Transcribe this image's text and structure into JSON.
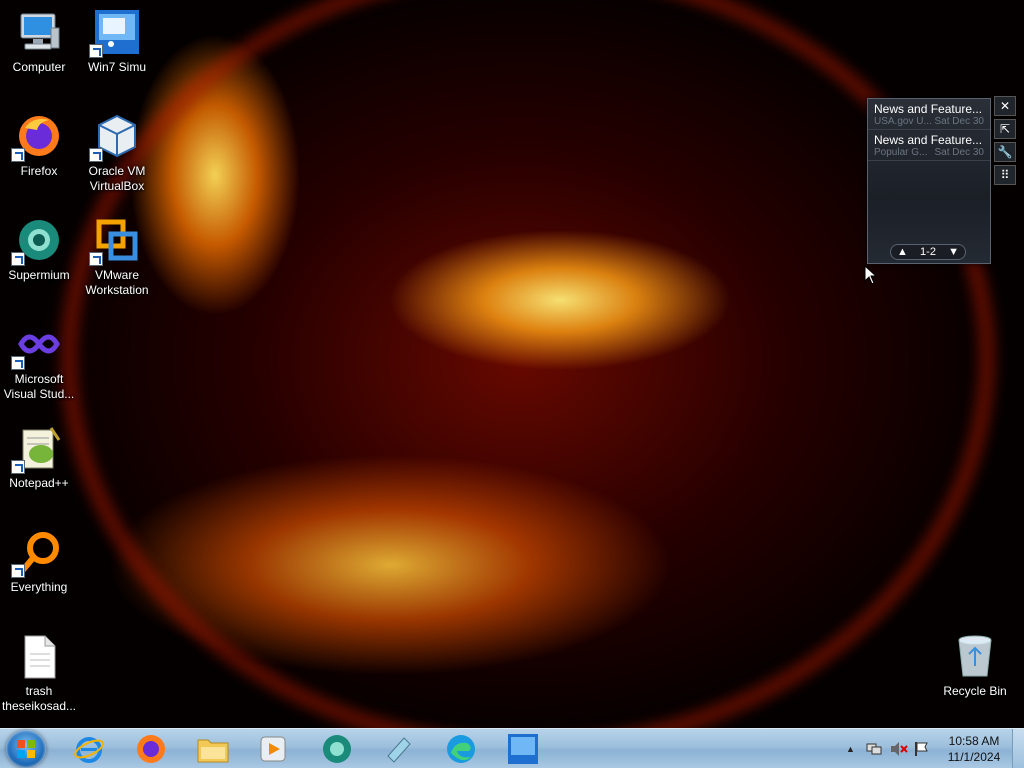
{
  "desktop": {
    "icons": [
      {
        "label": "Computer",
        "icon": "computer-icon"
      },
      {
        "label": "Win7 Simu",
        "icon": "win7-simu-icon"
      },
      {
        "label": "Firefox",
        "icon": "firefox-icon"
      },
      {
        "label": "Oracle VM VirtualBox",
        "icon": "virtualbox-icon"
      },
      {
        "label": "Supermium",
        "icon": "supermium-icon"
      },
      {
        "label": "VMware Workstation",
        "icon": "vmware-icon"
      },
      {
        "label": "Microsoft Visual Stud...",
        "icon": "visual-studio-icon"
      },
      {
        "label": "Notepad++",
        "icon": "notepadpp-icon"
      },
      {
        "label": "Everything",
        "icon": "everything-icon"
      },
      {
        "label": "trash theseikosad...",
        "icon": "text-file-icon"
      },
      {
        "label": "Recycle Bin",
        "icon": "recycle-bin-icon"
      }
    ]
  },
  "gadget": {
    "items": [
      {
        "title": "News and Feature...",
        "source": "USA.gov U...",
        "date": "Sat Dec 30"
      },
      {
        "title": "News and Feature...",
        "source": "Popular G...",
        "date": "Sat Dec 30"
      }
    ],
    "pager": "1-2",
    "tools": [
      "close-icon",
      "detach-icon",
      "options-icon",
      "drag-icon"
    ]
  },
  "taskbar": {
    "pinned": [
      "internet-explorer-icon",
      "firefox-icon",
      "file-explorer-icon",
      "media-player-icon",
      "supermium-icon",
      "pen-app-icon",
      "edge-icon",
      "win7-simu-icon"
    ],
    "tray": [
      "show-hidden-icons",
      "network-icon",
      "volume-muted-icon",
      "action-center-flag-icon"
    ],
    "clock_time": "10:58 AM",
    "clock_date": "11/1/2024"
  },
  "colors": {
    "taskbar": "#9dbfdc",
    "wallpaper_glow": "#ffb020"
  }
}
